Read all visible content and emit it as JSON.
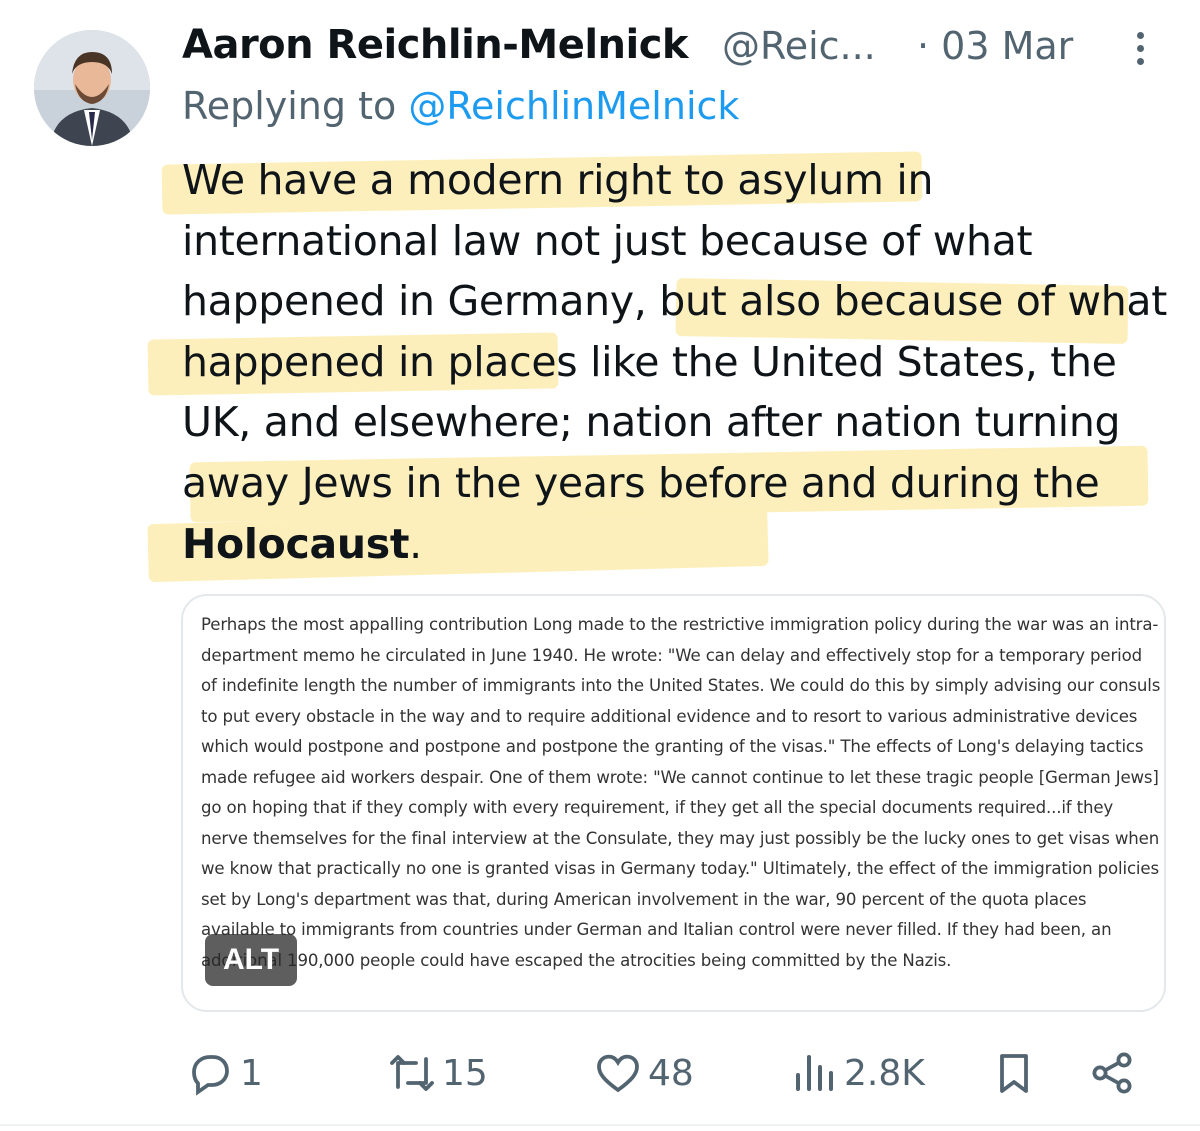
{
  "author": {
    "name": "Aaron Reichlin-Melnick",
    "handle": "@Reic...",
    "date": "· 03 Mar"
  },
  "reply": {
    "prefix": "Replying to",
    "mention": "@ReichlinMelnick"
  },
  "tweet": {
    "text_before_bold": "We have a modern right to asylum in international law not just because of what happened in Germany, but also because of what happened in places like the United States, the UK, and elsewhere; nation after nation turning away Jews in the years before and during the ",
    "bold_word": "Holocaust",
    "text_after_bold": "."
  },
  "media": {
    "text": "Perhaps the most appalling contribution Long made to the restrictive immigration policy during the war was an intra-department memo he circulated in June 1940. He wrote: \"We can delay and effectively stop for a temporary period of indefinite length the number of immigrants into the United States. We could do this by simply advising our consuls to put every obstacle in the way and to require additional evidence and to resort to various administrative devices which would postpone and postpone and postpone the granting of the visas.\" The effects of Long's delaying tactics made refugee aid workers despair. One of them wrote: \"We cannot continue to let these tragic people [German Jews] go on hoping that if they comply with every requirement, if they get all the special documents required...if they nerve themselves for the final interview at the Consulate, they may just possibly be the lucky ones to get visas when we know that practically no one is granted visas in Germany today.\" Ultimately, the effect of the immigration policies set by Long's department was that, during American involvement in the war, 90 percent of the quota places available to immigrants from countries under German and Italian control were never filled. If they had been, an additional 190,000 people could have escaped the atrocities being committed by the Nazis.",
    "alt_label": "ALT"
  },
  "actions": {
    "replies": "1",
    "reposts": "15",
    "likes": "48",
    "views": "2.8K"
  },
  "colors": {
    "highlight": "#fdeeb8",
    "link": "#1d9bf0",
    "muted": "#536471"
  }
}
